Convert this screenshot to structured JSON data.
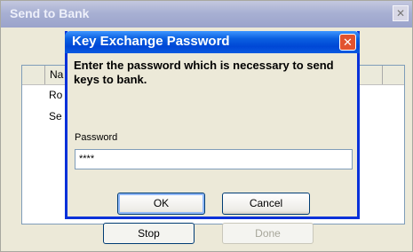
{
  "background_window": {
    "title": "Send to Bank",
    "close_symbol": "✕",
    "list": {
      "columns": [
        "",
        "Na"
      ],
      "rows": [
        "Ro",
        "Se"
      ]
    },
    "buttons": {
      "stop": "Stop",
      "done": "Done"
    }
  },
  "dialog": {
    "title": "Key Exchange Password",
    "close_symbol": "✕",
    "message": "Enter the password which is necessary to send keys to bank.",
    "password_label": "Password",
    "password_value": "****",
    "ok_label": "OK",
    "cancel_label": "Cancel"
  },
  "colors": {
    "title_active": "#0047d6",
    "title_inactive": "#a8b0d3",
    "window_face": "#ece9d8",
    "close_red": "#e2532f"
  }
}
